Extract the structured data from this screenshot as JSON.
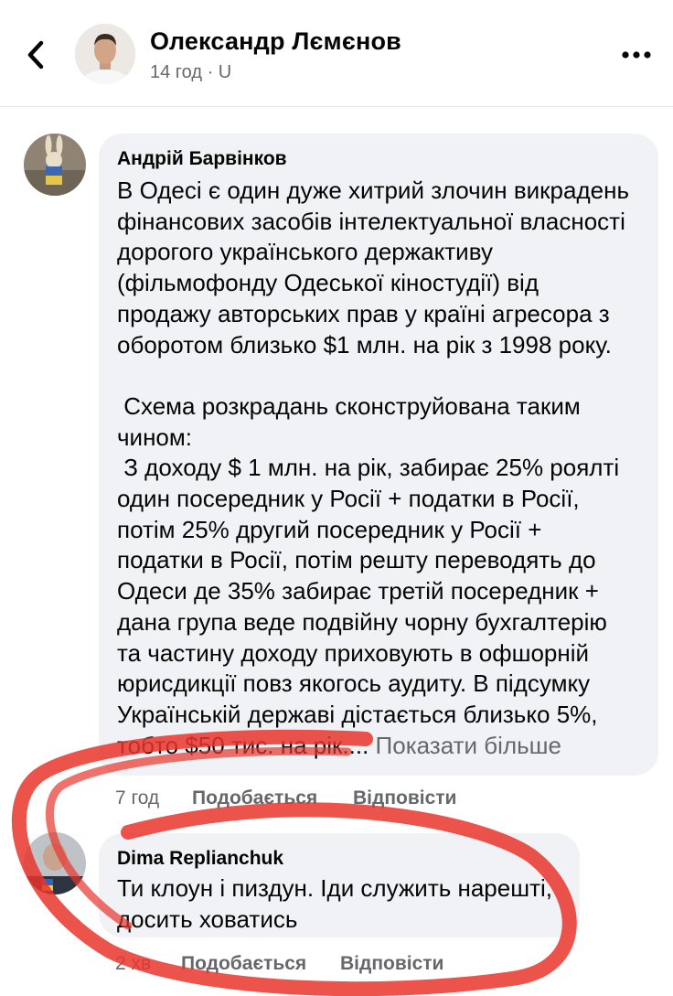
{
  "header": {
    "name": "Олександр Лємєнов",
    "meta": "14 год · U",
    "back_icon": "chevron-left-icon",
    "more_icon": "more-horizontal-icon"
  },
  "comments": [
    {
      "author": "Андрій Барвінков",
      "text": "В Одесі є один дуже хитрий злочин викрадень\nфінансових засобів інтелектуальної власності\nдорогого українського держактиву\n(фільмофонду Одеської кіностудії) від\nпродажу авторських прав у країні агресора з\nоборотом близько $1 млн. на рік з 1998 року.\n\n Схема розкрадань сконструйована таким\nчином:\n З доходу $ 1 млн. на рік, забирає 25% роялті\nодин посередник у Росії + податки в Росії,\nпотім 25% другий посередник у Росії +\nподатки в Росії, потім решту переводять до\nОдеси де 35% забирає третій посередник +\nдана група веде подвійну чорну бухгалтерію\nта частину доходу приховують в офшорній\nюрисдикції повз якогось аудиту. В підсумку\nУкраїнській державі дістається близько 5%,\nтобто $50 тис. на рік....",
      "see_more": "Показати більше",
      "time": "7 год",
      "like": "Подобається",
      "reply": "Відповісти"
    },
    {
      "author": "Dima Replianchuk",
      "text": "Ти клоун і пиздун. Іди служить нарешті,\nдосить ховатись",
      "time": "2 хв",
      "like": "Подобається",
      "reply": "Відповісти"
    }
  ],
  "colors": {
    "bubble": "#f0f2f5",
    "secondary_text": "#65676b",
    "scribble": "#e8352c"
  }
}
